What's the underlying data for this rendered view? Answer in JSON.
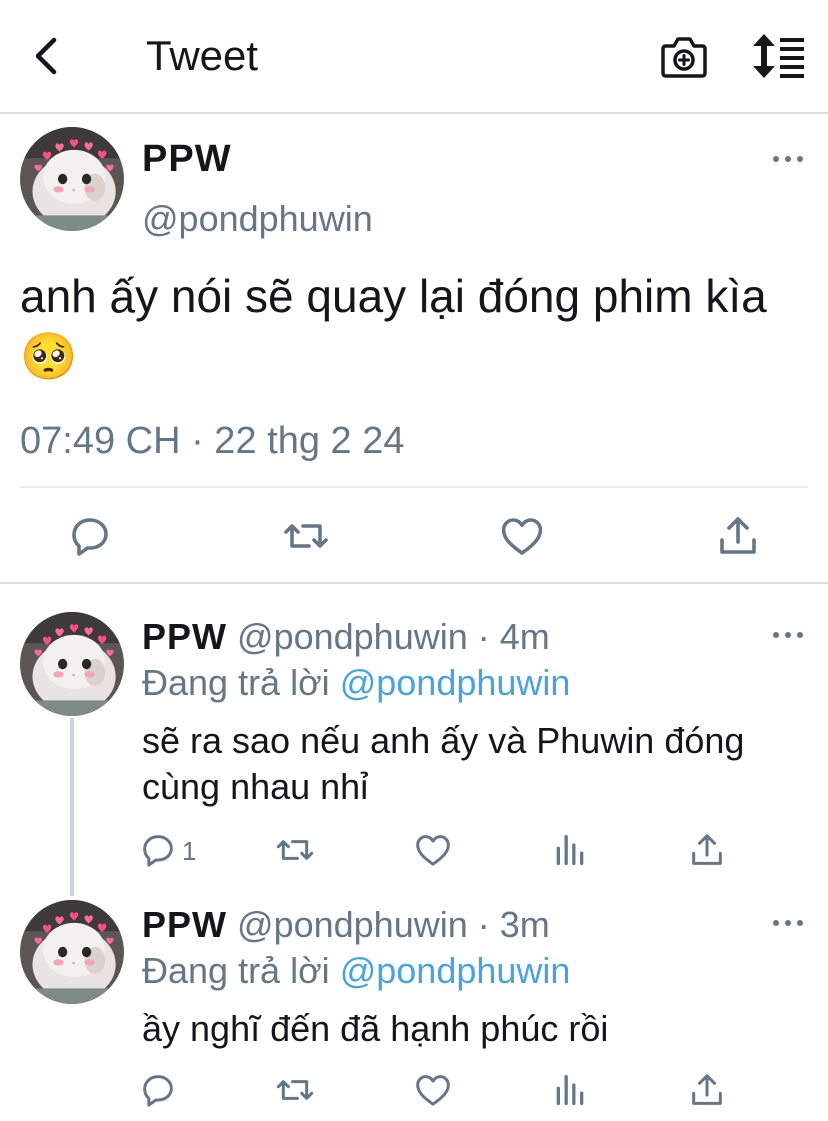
{
  "header": {
    "title": "Tweet"
  },
  "tweet": {
    "author_name": "PPW",
    "author_handle": "@pondphuwin",
    "text": "anh ấy nói sẽ quay lại đóng phim kìa 🥺",
    "timestamp": "07:49 CH · 22 thg 2 24"
  },
  "replies": [
    {
      "author_name": "PPW",
      "author_handle": "@pondphuwin",
      "time": "· 4m",
      "replying_label": "Đang trả lời",
      "replying_to": "@pondphuwin",
      "text": "sẽ ra sao nếu anh ấy và Phuwin đóng cùng nhau nhỉ",
      "reply_count": "1"
    },
    {
      "author_name": "PPW",
      "author_handle": "@pondphuwin",
      "time": "· 3m",
      "replying_label": "Đang trả lời",
      "replying_to": "@pondphuwin",
      "text": "ầy nghĩ đến đã hạnh phúc rồi",
      "reply_count": ""
    }
  ],
  "icons": {
    "back": "back-arrow-icon",
    "camera": "camera-icon",
    "sort": "sort-icon",
    "more": "more-icon",
    "reply": "reply-icon",
    "retweet": "retweet-icon",
    "like": "like-icon",
    "share": "share-icon",
    "analytics": "analytics-icon"
  },
  "colors": {
    "mention": "#4aa3df",
    "secondary_text": "#657786",
    "primary_text": "#14171a"
  }
}
